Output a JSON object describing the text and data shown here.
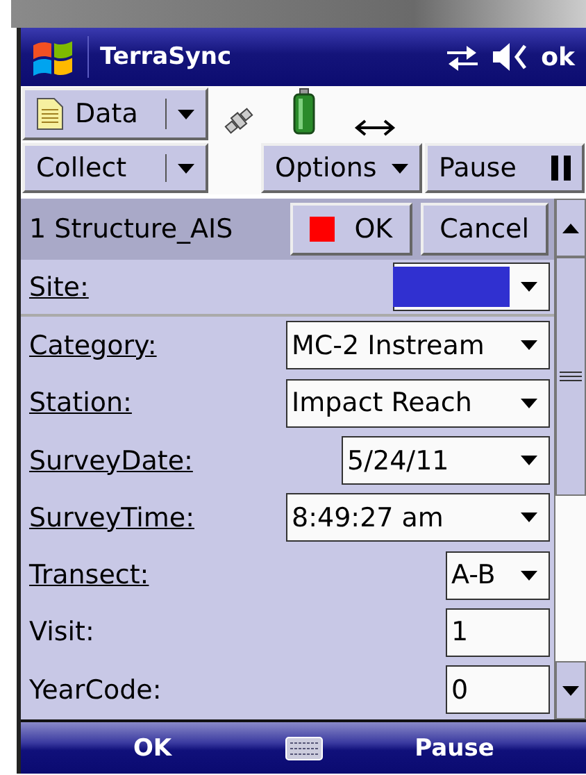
{
  "title_bar": {
    "app_name": "TerraSync",
    "status": "ok"
  },
  "toolbar": {
    "data_menu": "Data",
    "collect_menu": "Collect",
    "options_menu": "Options",
    "pause_button": "Pause"
  },
  "form": {
    "title": "1 Structure_AIS",
    "ok_button": "OK",
    "cancel_button": "Cancel",
    "fields": [
      {
        "label": "Site:",
        "required": true,
        "kind": "color",
        "color": "#3030d0"
      },
      {
        "label": "Category:",
        "required": true,
        "kind": "dropdown",
        "value": "MC-2 Instream"
      },
      {
        "label": "Station:",
        "required": true,
        "kind": "dropdown",
        "value": "Impact Reach"
      },
      {
        "label": "SurveyDate:",
        "required": true,
        "kind": "dropdown",
        "value": "5/24/11"
      },
      {
        "label": "SurveyTime:",
        "required": true,
        "kind": "dropdown",
        "value": "8:49:27 am"
      },
      {
        "label": "Transect:",
        "required": true,
        "kind": "dropdown",
        "value": "A-B"
      },
      {
        "label": "Visit:",
        "required": false,
        "kind": "text",
        "value": "1"
      },
      {
        "label": "YearCode:",
        "required": false,
        "kind": "text",
        "value": "0"
      }
    ]
  },
  "softkeys": {
    "left": "OK",
    "right": "Pause"
  }
}
